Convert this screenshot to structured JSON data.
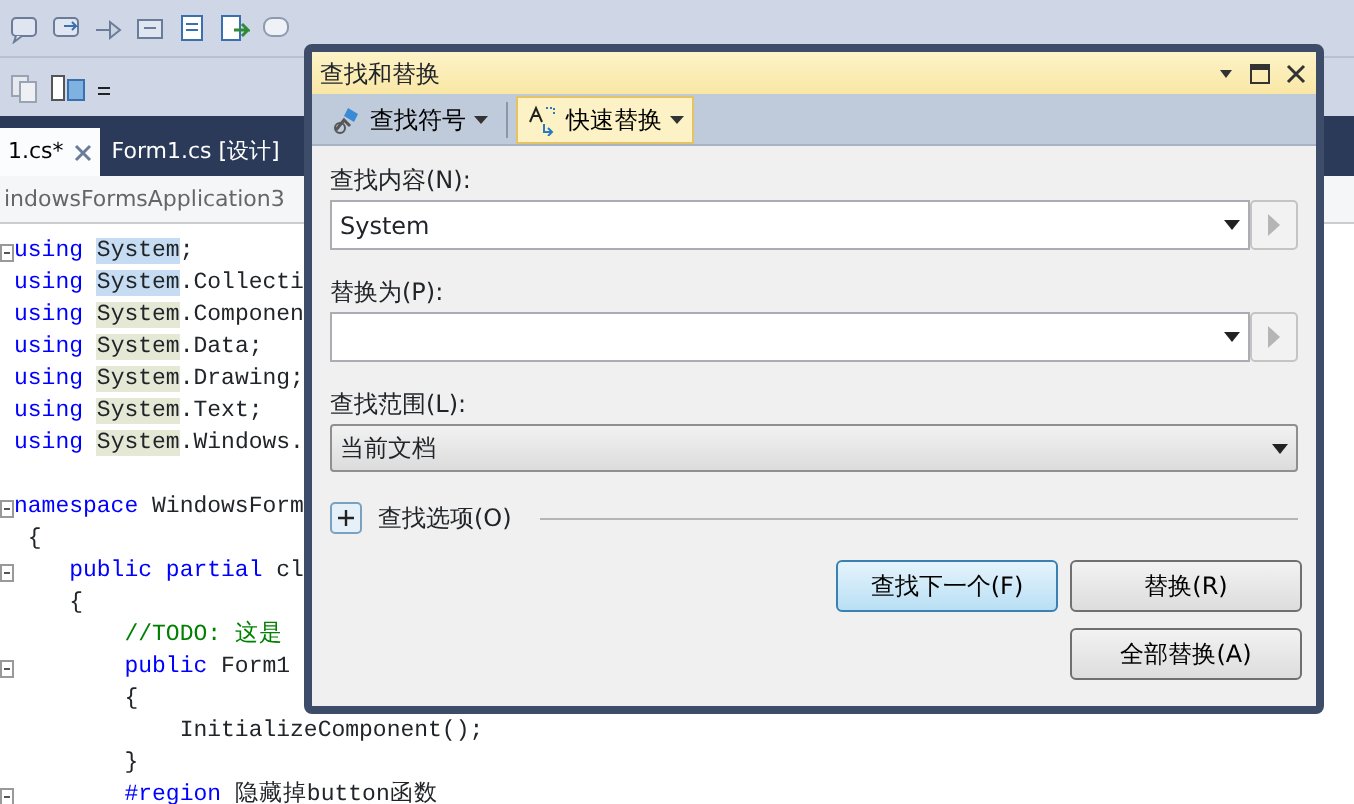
{
  "tabs": [
    {
      "label": "1.cs*",
      "selected": true
    },
    {
      "label": "Form1.cs [设计]",
      "selected": false
    }
  ],
  "breadcrumb": "indowsFormsApplication3",
  "code_lines": [
    {
      "fold": true,
      "parts": [
        {
          "text": "using ",
          "kind": "keyword"
        },
        {
          "text": "System",
          "kind": "match",
          "selected": true
        },
        {
          "text": ";"
        }
      ]
    },
    {
      "fold": false,
      "parts": [
        {
          "text": "using ",
          "kind": "keyword"
        },
        {
          "text": "System",
          "kind": "match",
          "selected": true
        },
        {
          "text": ".Collecti"
        }
      ]
    },
    {
      "fold": false,
      "parts": [
        {
          "text": "using ",
          "kind": "keyword"
        },
        {
          "text": "System",
          "kind": "match",
          "selected": false
        },
        {
          "text": ".Componen"
        }
      ]
    },
    {
      "fold": false,
      "parts": [
        {
          "text": "using ",
          "kind": "keyword"
        },
        {
          "text": "System",
          "kind": "match",
          "selected": false
        },
        {
          "text": ".Data;"
        }
      ]
    },
    {
      "fold": false,
      "parts": [
        {
          "text": "using ",
          "kind": "keyword"
        },
        {
          "text": "System",
          "kind": "match",
          "selected": false
        },
        {
          "text": ".Drawing;"
        }
      ]
    },
    {
      "fold": false,
      "parts": [
        {
          "text": "using ",
          "kind": "keyword"
        },
        {
          "text": "System",
          "kind": "match",
          "selected": false
        },
        {
          "text": ".Text;"
        }
      ]
    },
    {
      "fold": false,
      "parts": [
        {
          "text": "using ",
          "kind": "keyword"
        },
        {
          "text": "System",
          "kind": "match",
          "selected": false
        },
        {
          "text": ".Windows."
        }
      ]
    },
    {
      "fold": false
    },
    {
      "fold": true,
      "parts": [
        {
          "text": "namespace",
          "kind": "keyword"
        },
        {
          "text": " WindowsForm"
        }
      ]
    },
    {
      "fold": false,
      "parts": [
        {
          "text": " {"
        }
      ]
    },
    {
      "fold": true,
      "parts": [
        {
          "text": "    public partial",
          "kind": "keyword"
        },
        {
          "text": " cl"
        }
      ]
    },
    {
      "fold": false,
      "parts": [
        {
          "text": "    {"
        }
      ]
    },
    {
      "fold": false,
      "parts": [
        {
          "text": "        //TODO: 这是",
          "kind": "comment"
        }
      ]
    },
    {
      "fold": true,
      "parts": [
        {
          "text": "        public",
          "kind": "keyword"
        },
        {
          "text": " Form1"
        }
      ]
    },
    {
      "fold": false,
      "parts": [
        {
          "text": "        {"
        }
      ]
    },
    {
      "fold": false,
      "parts": [
        {
          "text": "            InitializeComponent();"
        }
      ]
    },
    {
      "fold": false,
      "parts": [
        {
          "text": "        }"
        }
      ]
    },
    {
      "fold": true,
      "parts": [
        {
          "text": "        #region",
          "kind": "keyword"
        },
        {
          "text": " 隐藏掉button函数"
        }
      ]
    }
  ],
  "dialog": {
    "title": "查找和替换",
    "toolbar": [
      {
        "label": "查找符号",
        "selected": false
      },
      {
        "label": "快速替换",
        "selected": true
      }
    ],
    "find_label": "查找内容(N):",
    "find_value": "System",
    "replace_label": "替换为(P):",
    "scope_label": "查找范围(L):",
    "scope_value": "当前文档",
    "options_label": "查找选项(O)",
    "options_expanded": false,
    "buttons": [
      {
        "label": "查找下一个(F)",
        "default": true
      },
      {
        "label": "替换(R)",
        "default": false
      },
      {
        "label": "全部替换(A)",
        "default": false
      }
    ]
  }
}
